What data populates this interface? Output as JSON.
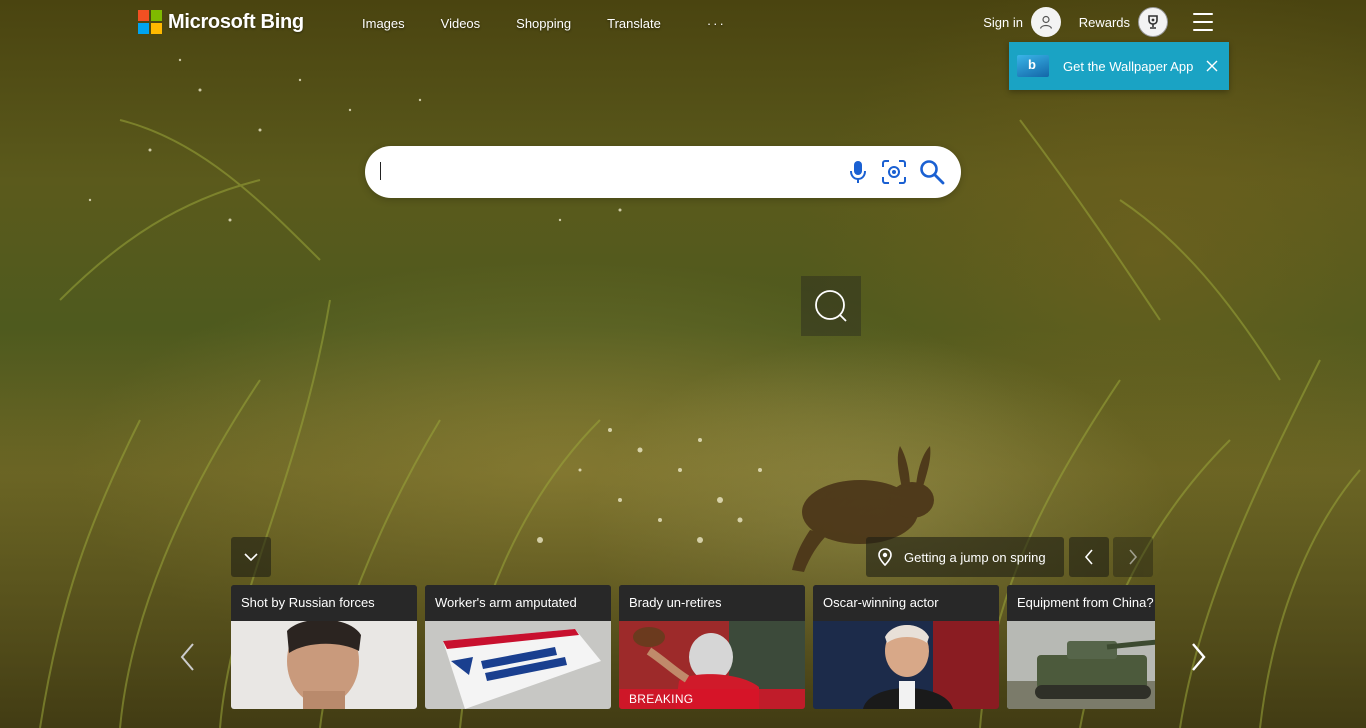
{
  "brand": {
    "name": "Microsoft Bing",
    "colors": [
      "#f25022",
      "#7fba00",
      "#00a4ef",
      "#ffb900"
    ]
  },
  "nav": {
    "items": [
      "Images",
      "Videos",
      "Shopping",
      "Translate"
    ],
    "more": "···"
  },
  "header": {
    "signin_label": "Sign in",
    "rewards_label": "Rewards"
  },
  "wallpaper_popup": {
    "label": "Get the Wallpaper App",
    "color": "#1aa3c4"
  },
  "search": {
    "value": "",
    "placeholder": ""
  },
  "story": {
    "label": "Getting a jump on spring"
  },
  "cards": [
    {
      "title": "Shot by Russian forces",
      "badge": ""
    },
    {
      "title": "Worker's arm amputated",
      "badge": ""
    },
    {
      "title": "Brady un-retires",
      "badge": "BREAKING"
    },
    {
      "title": "Oscar-winning actor",
      "badge": ""
    },
    {
      "title": "Equipment from China?",
      "badge": ""
    }
  ]
}
